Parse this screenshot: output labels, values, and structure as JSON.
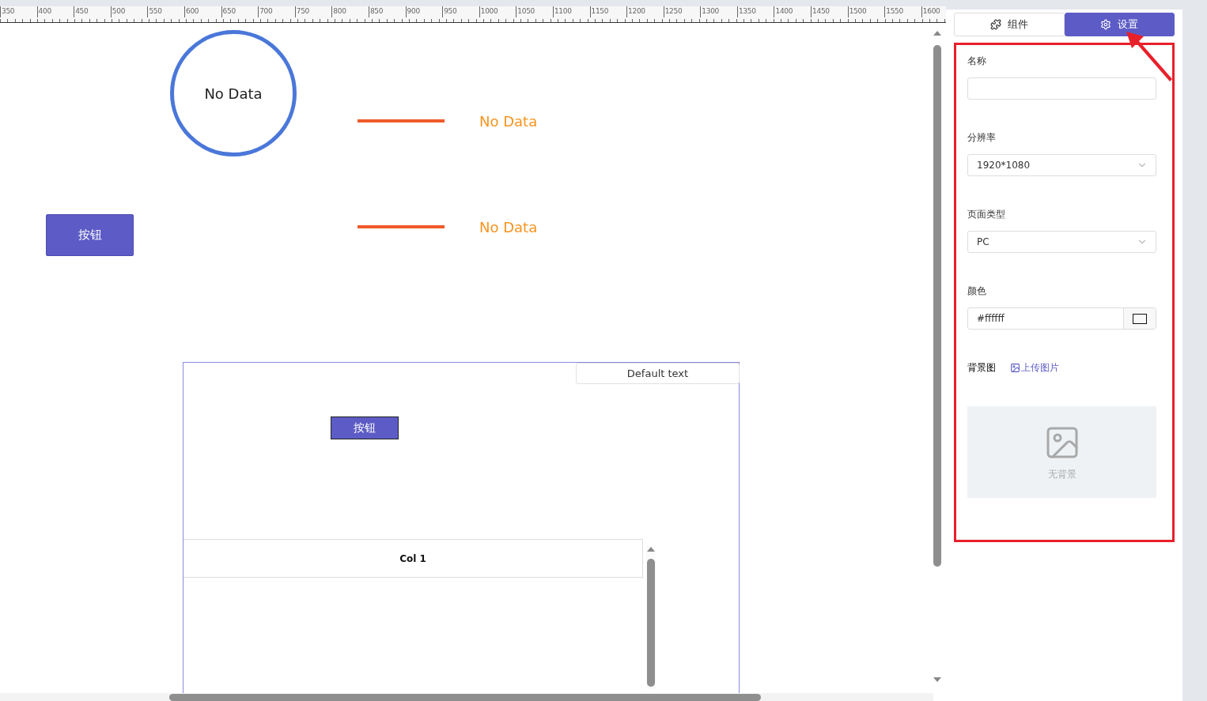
{
  "ruler": {
    "labels": [
      "350",
      "400",
      "450",
      "500",
      "550",
      "600",
      "650",
      "700",
      "750",
      "800",
      "850",
      "900",
      "950",
      "1000",
      "1050",
      "1100",
      "1150",
      "1200",
      "1250",
      "1300",
      "1350",
      "1400",
      "1450",
      "1500",
      "1550",
      "1600"
    ]
  },
  "canvas": {
    "gauge": {
      "text": "No Data"
    },
    "lines": [
      {
        "text": "No Data",
        "color": "#f05a28"
      },
      {
        "text": "No Data",
        "color": "#f05a28"
      }
    ],
    "button": {
      "label": "按钮"
    },
    "container": {
      "tab": "Default text",
      "button": {
        "label": "按钮"
      },
      "table": {
        "columns": [
          "Col 1"
        ]
      }
    }
  },
  "panel": {
    "tabs": [
      {
        "label": "组件",
        "selected": false
      },
      {
        "label": "设置",
        "selected": true
      }
    ],
    "fields": [
      {
        "kind": "input",
        "label": "名称"
      },
      {
        "kind": "select",
        "label": "分辨率",
        "value": "1920*1080"
      },
      {
        "kind": "select",
        "label": "页面类型",
        "value": "PC"
      },
      {
        "kind": "color",
        "label": "颜色",
        "value": "#ffffff"
      }
    ],
    "background": {
      "label": "背景图",
      "upload": "上传图片",
      "empty": "无背景"
    }
  }
}
